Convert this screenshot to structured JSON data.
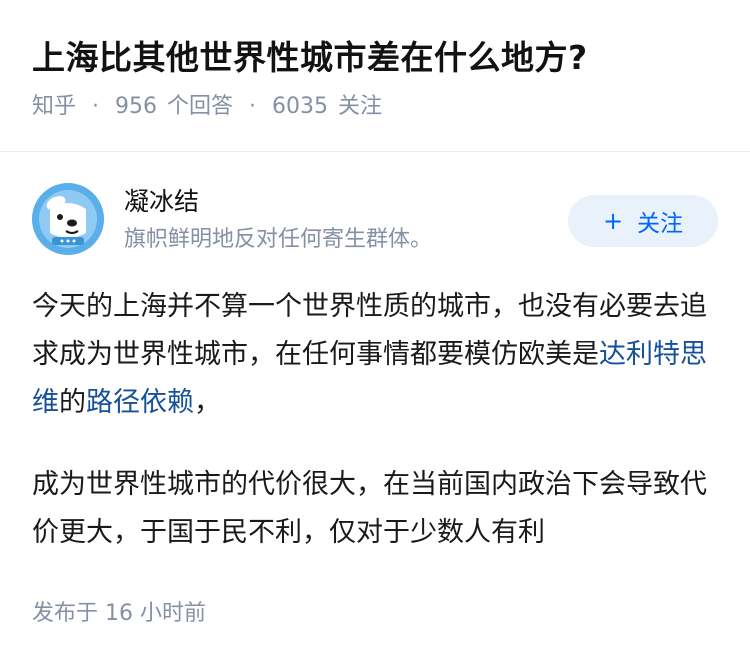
{
  "question": {
    "title": "上海比其他世界性城市差在什么地方?",
    "source": "知乎",
    "separator": "·",
    "answers_count": "956",
    "answers_label": "个回答",
    "followers_count": "6035",
    "followers_label": "关注"
  },
  "answer": {
    "author": {
      "name": "凝冰结",
      "bio": "旗帜鲜明地反对任何寄生群体。",
      "avatar_icon": "dog-avatar-icon"
    },
    "follow_button": {
      "plus": "+",
      "label": "关注"
    },
    "paragraphs": [
      {
        "text_before": "今天的上海并不算一个世界性质的城市，也没有必要去追求成为世界性城市，在任何事情都要模仿欧美是",
        "link1": "达利特思维",
        "text_middle": "的",
        "link2": "路径依赖",
        "text_after": "，"
      },
      {
        "text": "成为世界性城市的代价很大，在当前国内政治下会导致代价更大，于国于民不利，仅对于少数人有利"
      }
    ],
    "published": "发布于  16 小时前"
  },
  "colors": {
    "link": "#175199",
    "meta": "#8590a6",
    "follow_bg": "#e9f1fb",
    "follow_text": "#0066ff"
  }
}
